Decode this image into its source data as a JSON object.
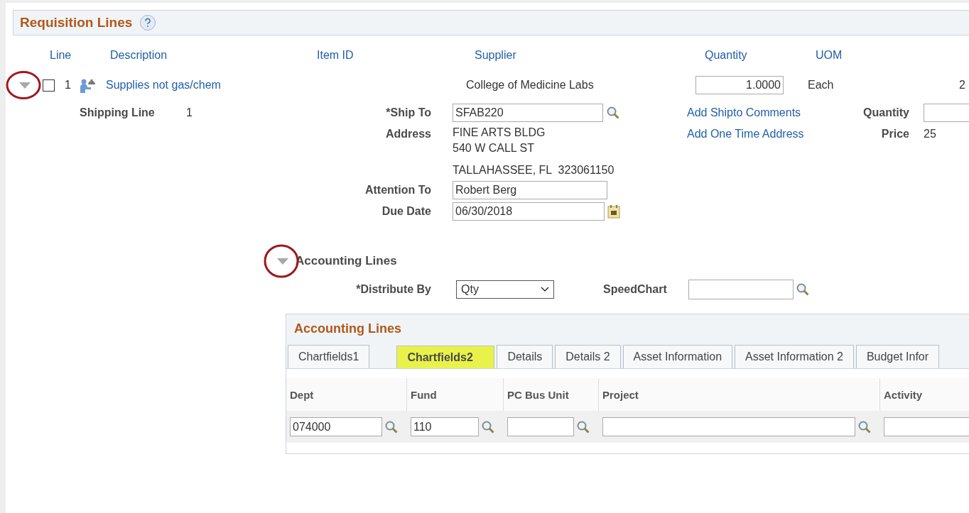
{
  "section": {
    "title": "Requisition Lines"
  },
  "columns": [
    "Line",
    "Description",
    "Item ID",
    "Supplier",
    "Quantity",
    "UOM"
  ],
  "line": {
    "expanded": true,
    "checked": false,
    "number": "1",
    "description": "Supplies not gas/chem",
    "supplier": "College of Medicine Labs",
    "quantity": "1.0000",
    "uom": "Each",
    "column_7": "2"
  },
  "shipping": {
    "label": "Shipping Line",
    "number": "1",
    "ship_to_label": "*Ship To",
    "ship_to": "SFAB220",
    "address_label": "Address",
    "address": [
      "FINE ARTS BLDG",
      "540 W CALL ST",
      "TALLAHASSEE, FL  323061150"
    ],
    "links": [
      "Add Shipto Comments",
      "Add One Time Address"
    ],
    "quantity_label": "Quantity",
    "price_label": "Price",
    "price": "25",
    "attention_label": "Attention To",
    "attention": "Robert Berg",
    "due_label": "Due Date",
    "due": "06/30/2018"
  },
  "accounting": {
    "title": "Accounting Lines",
    "expanded": true,
    "distribute_label": "*Distribute By",
    "distribute": "Qty",
    "speedchart_label": "SpeedChart",
    "panel_title": "Accounting Lines",
    "tabs": [
      {
        "label": "Chartfields1",
        "selected": false
      },
      {
        "label": "Chartfields2",
        "selected": true
      },
      {
        "label": "Details",
        "selected": false
      },
      {
        "label": "Details 2",
        "selected": false
      },
      {
        "label": "Asset Information",
        "selected": false
      },
      {
        "label": "Asset Information 2",
        "selected": false
      },
      {
        "label": "Budget Infor",
        "selected": false
      }
    ],
    "columns": [
      {
        "heading": "Dept",
        "value": "074000"
      },
      {
        "heading": "Fund",
        "value": "110"
      },
      {
        "heading": "PC Bus Unit"
      },
      {
        "heading": "Project"
      },
      {
        "heading": "Activity"
      }
    ]
  }
}
